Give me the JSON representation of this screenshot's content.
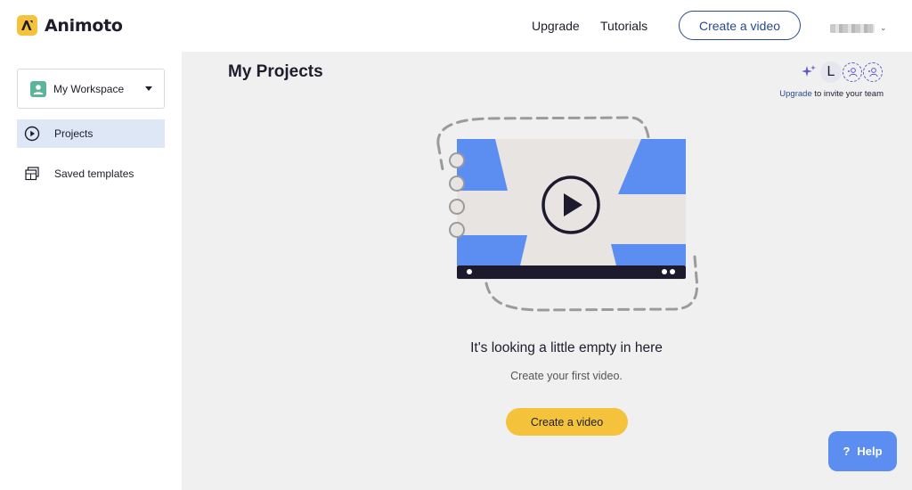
{
  "app": {
    "name": "Animoto"
  },
  "header": {
    "upgrade_label": "Upgrade",
    "tutorials_label": "Tutorials",
    "create_label": "Create a video"
  },
  "sidebar": {
    "workspace_label": "My Workspace",
    "items": [
      {
        "label": "Projects",
        "icon": "play-circle-icon",
        "active": true
      },
      {
        "label": "Saved templates",
        "icon": "templates-icon",
        "active": false
      }
    ]
  },
  "main": {
    "title": "My Projects",
    "avatar_initial": "L",
    "invite_link": "Upgrade",
    "invite_text": " to invite your team",
    "empty_title": "It's looking a little empty in here",
    "empty_subtitle": "Create your first video.",
    "cta_label": "Create a video",
    "help_label": "Help",
    "help_glyph": "?"
  },
  "colors": {
    "accent_yellow": "#f5c33b",
    "primary_blue": "#2a4a8c",
    "active_nav_bg": "#dde7f5",
    "help_blue": "#5b8ef0",
    "main_bg": "#f1f0f1"
  }
}
